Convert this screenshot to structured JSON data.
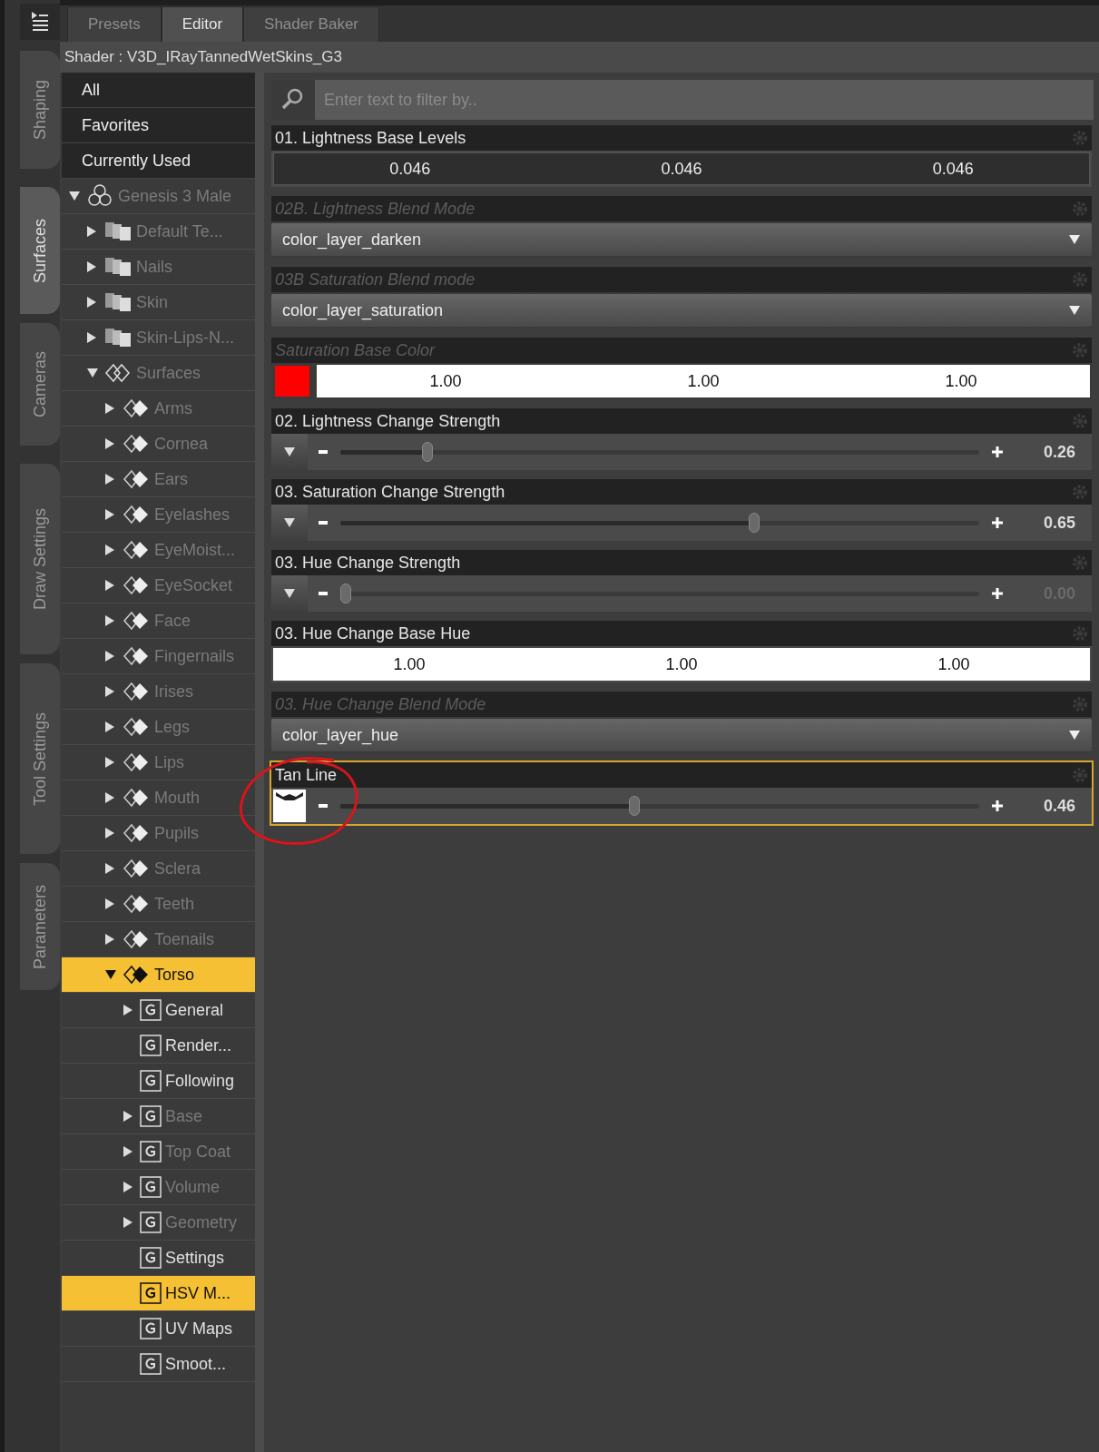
{
  "side_tabs": [
    {
      "label": "Shaping",
      "selected": false
    },
    {
      "label": "Surfaces",
      "selected": true
    },
    {
      "label": "Cameras",
      "selected": false
    },
    {
      "label": "Draw Settings",
      "selected": false
    },
    {
      "label": "Tool Settings",
      "selected": false
    },
    {
      "label": "Parameters",
      "selected": false
    }
  ],
  "tabs": [
    {
      "label": "Presets",
      "selected": false
    },
    {
      "label": "Editor",
      "selected": true
    },
    {
      "label": "Shader Baker",
      "selected": false
    }
  ],
  "shader_label": "Shader : V3D_IRayTannedWetSkins_G3",
  "filters": [
    {
      "label": "All"
    },
    {
      "label": "Favorites"
    },
    {
      "label": "Currently Used"
    }
  ],
  "tree": [
    {
      "label": "Genesis 3 Male",
      "kind": "figure",
      "dimmed": true,
      "selected": false,
      "expanded": true,
      "children": [
        {
          "label": "Default Te...",
          "kind": "materials",
          "dimmed": true,
          "selected": false,
          "expanded": false
        },
        {
          "label": "Nails",
          "kind": "materials",
          "dimmed": true,
          "selected": false,
          "expanded": false
        },
        {
          "label": "Skin",
          "kind": "materials",
          "dimmed": true,
          "selected": false,
          "expanded": false
        },
        {
          "label": "Skin-Lips-N...",
          "kind": "materials",
          "dimmed": true,
          "selected": false,
          "expanded": false
        },
        {
          "label": "Surfaces",
          "kind": "surfaces",
          "dimmed": true,
          "selected": false,
          "expanded": true,
          "children": [
            {
              "label": "Arms",
              "kind": "surface",
              "dimmed": true,
              "selected": false,
              "expanded": false
            },
            {
              "label": "Cornea",
              "kind": "surface",
              "dimmed": true,
              "selected": false,
              "expanded": false
            },
            {
              "label": "Ears",
              "kind": "surface",
              "dimmed": true,
              "selected": false,
              "expanded": false
            },
            {
              "label": "Eyelashes",
              "kind": "surface",
              "dimmed": true,
              "selected": false,
              "expanded": false
            },
            {
              "label": "EyeMoist...",
              "kind": "surface",
              "dimmed": true,
              "selected": false,
              "expanded": false
            },
            {
              "label": "EyeSocket",
              "kind": "surface",
              "dimmed": true,
              "selected": false,
              "expanded": false
            },
            {
              "label": "Face",
              "kind": "surface",
              "dimmed": true,
              "selected": false,
              "expanded": false
            },
            {
              "label": "Fingernails",
              "kind": "surface",
              "dimmed": true,
              "selected": false,
              "expanded": false
            },
            {
              "label": "Irises",
              "kind": "surface",
              "dimmed": true,
              "selected": false,
              "expanded": false
            },
            {
              "label": "Legs",
              "kind": "surface",
              "dimmed": true,
              "selected": false,
              "expanded": false
            },
            {
              "label": "Lips",
              "kind": "surface",
              "dimmed": true,
              "selected": false,
              "expanded": false
            },
            {
              "label": "Mouth",
              "kind": "surface",
              "dimmed": true,
              "selected": false,
              "expanded": false
            },
            {
              "label": "Pupils",
              "kind": "surface",
              "dimmed": true,
              "selected": false,
              "expanded": false
            },
            {
              "label": "Sclera",
              "kind": "surface",
              "dimmed": true,
              "selected": false,
              "expanded": false
            },
            {
              "label": "Teeth",
              "kind": "surface",
              "dimmed": true,
              "selected": false,
              "expanded": false
            },
            {
              "label": "Toenails",
              "kind": "surface",
              "dimmed": true,
              "selected": false,
              "expanded": false
            },
            {
              "label": "Torso",
              "kind": "surface",
              "dimmed": false,
              "selected": true,
              "expanded": true,
              "children": [
                {
                  "label": "General",
                  "kind": "group",
                  "dimmed": false,
                  "selected": false,
                  "expanded": false
                },
                {
                  "label": "Render...",
                  "kind": "group",
                  "dimmed": false,
                  "selected": false
                },
                {
                  "label": "Following",
                  "kind": "group",
                  "dimmed": false,
                  "selected": false
                },
                {
                  "label": "Base",
                  "kind": "group",
                  "dimmed": true,
                  "selected": false,
                  "expanded": false
                },
                {
                  "label": "Top Coat",
                  "kind": "group",
                  "dimmed": true,
                  "selected": false,
                  "expanded": false
                },
                {
                  "label": "Volume",
                  "kind": "group",
                  "dimmed": true,
                  "selected": false,
                  "expanded": false
                },
                {
                  "label": "Geometry",
                  "kind": "group",
                  "dimmed": true,
                  "selected": false,
                  "expanded": false
                },
                {
                  "label": "Settings",
                  "kind": "group",
                  "dimmed": false,
                  "selected": false
                },
                {
                  "label": "HSV M...",
                  "kind": "group",
                  "dimmed": false,
                  "selected": true
                },
                {
                  "label": "UV Maps",
                  "kind": "group",
                  "dimmed": false,
                  "selected": false
                },
                {
                  "label": "Smoot...",
                  "kind": "group",
                  "dimmed": false,
                  "selected": false
                }
              ]
            }
          ]
        }
      ]
    }
  ],
  "search": {
    "placeholder": "Enter text to filter by.."
  },
  "properties": [
    {
      "label": "01. Lightness Base Levels",
      "kind": "triple",
      "dimmed": false,
      "selected": false,
      "values": [
        "0.046",
        "0.046",
        "0.046"
      ]
    },
    {
      "label": "02B. Lightness Blend Mode",
      "kind": "dropdown",
      "dimmed": true,
      "selected": false,
      "value": "color_layer_darken"
    },
    {
      "label": "03B Saturation Blend mode",
      "kind": "dropdown",
      "dimmed": true,
      "selected": false,
      "value": "color_layer_saturation"
    },
    {
      "label": "Saturation Base Color",
      "kind": "color",
      "dimmed": true,
      "selected": false,
      "color": "#ff0000",
      "values": [
        "1.00",
        "1.00",
        "1.00"
      ]
    },
    {
      "label": "02. Lightness Change Strength",
      "kind": "slider",
      "dimmed": false,
      "selected": false,
      "level": 0.13,
      "value": "0.26",
      "value_dimmed": false
    },
    {
      "label": "03. Saturation Change Strength",
      "kind": "slider",
      "dimmed": false,
      "selected": false,
      "level": 0.65,
      "value": "0.65",
      "value_dimmed": false
    },
    {
      "label": "03. Hue Change Strength",
      "kind": "slider",
      "dimmed": false,
      "selected": false,
      "level": 0,
      "value": "0.00",
      "value_dimmed": true
    },
    {
      "label": "03. Hue Change Base Hue",
      "kind": "triple_white",
      "dimmed": false,
      "selected": false,
      "values": [
        "1.00",
        "1.00",
        "1.00"
      ]
    },
    {
      "label": "03. Hue Change Blend Mode",
      "kind": "dropdown",
      "dimmed": true,
      "selected": false,
      "value": "color_layer_hue"
    },
    {
      "label": "Tan Line",
      "kind": "image_slider",
      "dimmed": false,
      "selected": true,
      "level": 0.46,
      "value": "0.46",
      "value_dimmed": false
    }
  ]
}
